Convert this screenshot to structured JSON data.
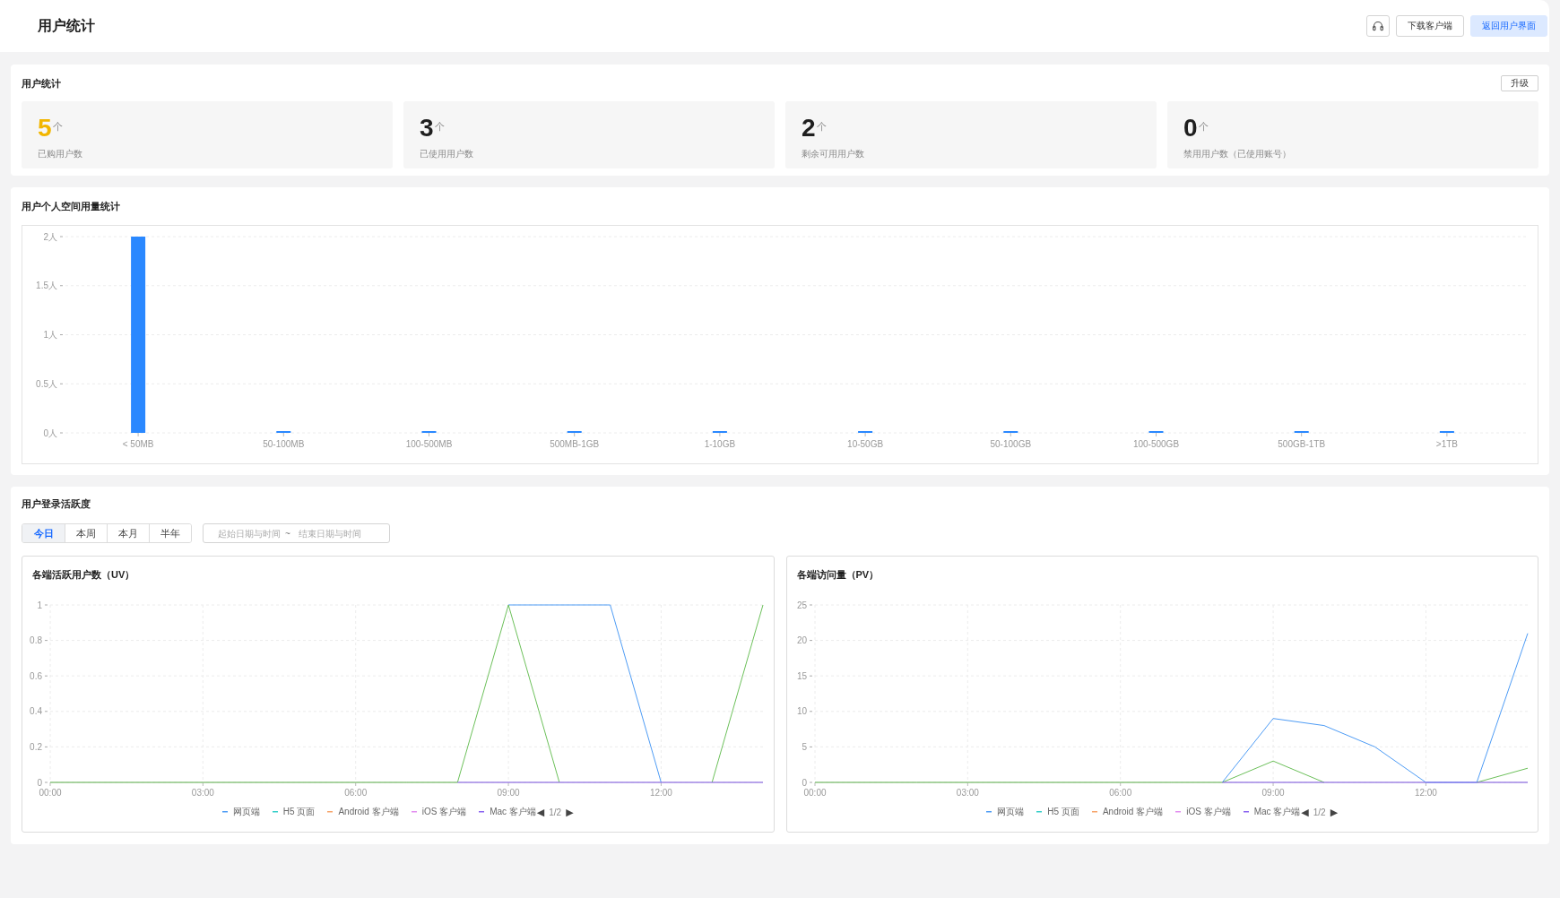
{
  "header": {
    "title": "用户统计",
    "buttons": [
      {
        "kind": "icon"
      },
      {
        "kind": "text",
        "label": "下载客户端",
        "primary": false
      },
      {
        "kind": "text",
        "label": "返回用户界面",
        "primary": true
      }
    ]
  },
  "user_stats": {
    "title": "用户统计",
    "upgrade_button": "升级",
    "cards": [
      {
        "value": "5",
        "unit": "个",
        "label": "已购用户数",
        "color": "#f2b600"
      },
      {
        "value": "3",
        "unit": "个",
        "label": "已使用用户数",
        "color": "#1f1f1f"
      },
      {
        "value": "2",
        "unit": "个",
        "label": "剩余可用用户数",
        "color": "#1f1f1f"
      },
      {
        "value": "0",
        "unit": "个",
        "label": "禁用用户数（已使用账号）",
        "color": "#1f1f1f"
      }
    ]
  },
  "storage_usage": {
    "title": "用户个人空间用量统计",
    "chart_data": {
      "type": "bar",
      "categories": [
        "< 50MB",
        "50-100MB",
        "100-500MB",
        "500MB-1GB",
        "1-10GB",
        "10-50GB",
        "50-100GB",
        "100-500GB",
        "500GB-1TB",
        ">1TB"
      ],
      "values": [
        2,
        0,
        0,
        0,
        0,
        0,
        0,
        0,
        0,
        0
      ],
      "ylim": [
        0,
        2
      ],
      "yticks": [
        {
          "value": 0,
          "label": "0人"
        },
        {
          "value": 0.5,
          "label": "0.5人"
        },
        {
          "value": 1,
          "label": "1人"
        },
        {
          "value": 1.5,
          "label": "1.5人"
        },
        {
          "value": 2,
          "label": "2人"
        }
      ],
      "grid": true
    }
  },
  "activity": {
    "title": "用户登录活跃度",
    "periods": [
      {
        "label": "今日",
        "selected": true
      },
      {
        "label": "本周",
        "selected": false
      },
      {
        "label": "本月",
        "selected": false
      },
      {
        "label": "半年",
        "selected": false
      }
    ],
    "date_range": {
      "start_placeholder": "起始日期与时间",
      "separator": "~",
      "end_placeholder": "结束日期与时间"
    },
    "charts": [
      {
        "chart_data": {
          "type": "line",
          "title": "各端活跃用户数（UV）",
          "x": [
            0,
            1,
            2,
            3,
            4,
            5,
            6,
            7,
            8,
            9,
            10,
            11,
            12,
            13,
            14
          ],
          "xlim": [
            0,
            14
          ],
          "xticks": [
            {
              "value": 0,
              "label": "00:00"
            },
            {
              "value": 3,
              "label": "03:00"
            },
            {
              "value": 6,
              "label": "06:00"
            },
            {
              "value": 9,
              "label": "09:00"
            },
            {
              "value": 12,
              "label": "12:00"
            }
          ],
          "ylim": [
            0,
            1
          ],
          "yticks": [
            0,
            0.2,
            0.4,
            0.6,
            0.8,
            1
          ],
          "grid": true,
          "legend": "bottom",
          "series": [
            {
              "name": "网页端",
              "color": "#4e9cf5",
              "values": [
                null,
                null,
                null,
                null,
                null,
                null,
                null,
                null,
                null,
                1,
                1,
                1,
                0,
                null,
                null
              ]
            },
            {
              "name": "H5 页面",
              "color": "#36cfc9",
              "values": [
                null,
                null,
                null,
                null,
                null,
                null,
                null,
                null,
                null,
                null,
                null,
                null,
                null,
                null,
                null
              ]
            },
            {
              "name": "Android 客户端",
              "color": "#f7a46b",
              "values": [
                null,
                null,
                null,
                null,
                null,
                null,
                null,
                null,
                null,
                null,
                null,
                null,
                null,
                null,
                null
              ]
            },
            {
              "name": "iOS 客户端",
              "color": "#e38ef0",
              "values": [
                null,
                null,
                null,
                null,
                null,
                null,
                null,
                null,
                null,
                null,
                null,
                null,
                null,
                null,
                null
              ]
            },
            {
              "color": "#6cc05a",
              "values": [
                0,
                0,
                0,
                0,
                0,
                0,
                0,
                0,
                0,
                1,
                0,
                null,
                null,
                0,
                1
              ]
            },
            {
              "name": "Mac 客户端",
              "color": "#8a63f0",
              "values": [
                null,
                null,
                null,
                null,
                null,
                null,
                null,
                null,
                0,
                0,
                0,
                0,
                0,
                0,
                0
              ]
            }
          ]
        },
        "legend_pager": {
          "prev": "◀",
          "page": "1/2",
          "next": "▶"
        }
      },
      {
        "chart_data": {
          "type": "line",
          "title": "各端访问量（PV）",
          "x": [
            0,
            1,
            2,
            3,
            4,
            5,
            6,
            7,
            8,
            9,
            10,
            11,
            12,
            13,
            14
          ],
          "xlim": [
            0,
            14
          ],
          "xticks": [
            {
              "value": 0,
              "label": "00:00"
            },
            {
              "value": 3,
              "label": "03:00"
            },
            {
              "value": 6,
              "label": "06:00"
            },
            {
              "value": 9,
              "label": "09:00"
            },
            {
              "value": 12,
              "label": "12:00"
            }
          ],
          "ylim": [
            0,
            25
          ],
          "yticks": [
            0,
            5,
            10,
            15,
            20,
            25
          ],
          "grid": true,
          "legend": "bottom",
          "series": [
            {
              "name": "网页端",
              "color": "#4e9cf5",
              "values": [
                null,
                null,
                null,
                null,
                null,
                null,
                null,
                null,
                0,
                9,
                8,
                5,
                0,
                0,
                21
              ]
            },
            {
              "name": "H5 页面",
              "color": "#36cfc9",
              "values": [
                null,
                null,
                null,
                null,
                null,
                null,
                null,
                null,
                null,
                null,
                null,
                null,
                null,
                null,
                null
              ]
            },
            {
              "name": "Android 客户端",
              "color": "#f7a46b",
              "values": [
                null,
                null,
                null,
                null,
                null,
                null,
                null,
                null,
                null,
                null,
                null,
                null,
                null,
                null,
                null
              ]
            },
            {
              "name": "iOS 客户端",
              "color": "#e38ef0",
              "values": [
                null,
                null,
                null,
                null,
                null,
                null,
                null,
                null,
                null,
                null,
                null,
                null,
                null,
                null,
                null
              ]
            },
            {
              "color": "#6cc05a",
              "values": [
                0,
                0,
                0,
                0,
                0,
                0,
                0,
                0,
                0,
                3,
                0,
                null,
                null,
                0,
                2
              ]
            },
            {
              "name": "Mac 客户端",
              "color": "#8a63f0",
              "values": [
                null,
                null,
                null,
                null,
                null,
                null,
                null,
                null,
                0,
                0,
                0,
                0,
                0,
                0,
                0
              ]
            }
          ]
        },
        "legend_pager": {
          "prev": "◀",
          "page": "1/2",
          "next": "▶"
        }
      }
    ]
  }
}
